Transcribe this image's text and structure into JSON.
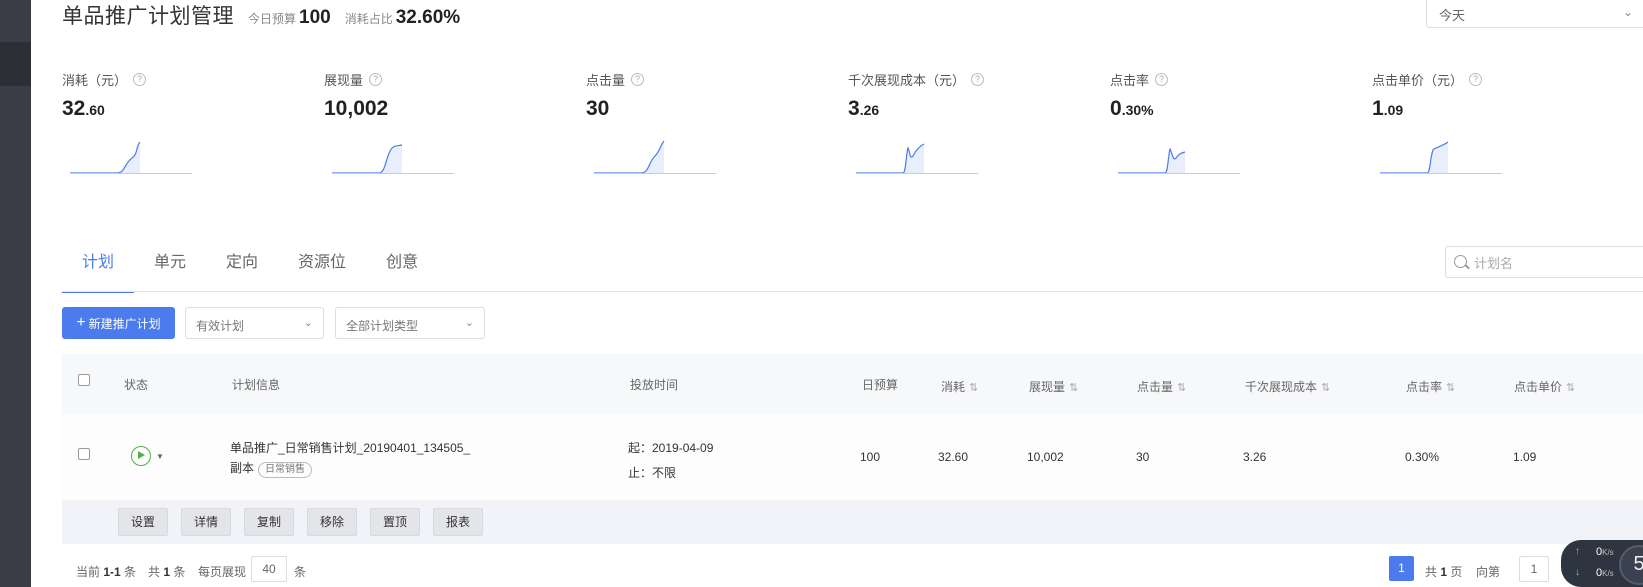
{
  "header": {
    "title": "单品推广计划管理",
    "budget_label": "今日预算",
    "budget_value": "100",
    "ratio_label": "消耗占比",
    "ratio_value": "32.60%",
    "date_select": "今天"
  },
  "metrics": [
    {
      "label": "消耗（元）",
      "value_int": "32",
      "value_frac": ".60"
    },
    {
      "label": "展现量",
      "value_int": "10,002",
      "value_frac": ""
    },
    {
      "label": "点击量",
      "value_int": "30",
      "value_frac": ""
    },
    {
      "label": "千次展现成本（元）",
      "value_int": "3",
      "value_frac": ".26"
    },
    {
      "label": "点击率",
      "value_int": "0",
      "value_frac": ".30%"
    },
    {
      "label": "点击单价（元）",
      "value_int": "1",
      "value_frac": ".09"
    }
  ],
  "tabs": [
    "计划",
    "单元",
    "定向",
    "资源位",
    "创意"
  ],
  "search": {
    "placeholder": "计划名"
  },
  "toolbar": {
    "new_button": "新建推广计划",
    "filter_status": "有效计划",
    "filter_type": "全部计划类型"
  },
  "table": {
    "headers": {
      "status": "状态",
      "info": "计划信息",
      "time": "投放时间",
      "budget": "日预算",
      "cost": "消耗",
      "impressions": "展现量",
      "clicks": "点击量",
      "cpm": "千次展现成本",
      "ctr": "点击率",
      "cpc": "点击单价"
    },
    "rows": [
      {
        "name_line1": "单品推广_日常销售计划_20190401_134505_",
        "name_line2": "副本",
        "tag": "日常销售",
        "start": "起：2019-04-09",
        "end": "止：不限",
        "budget": "100",
        "cost": "32.60",
        "impressions": "10,002",
        "clicks": "30",
        "cpm": "3.26",
        "ctr": "0.30%",
        "cpc": "1.09"
      }
    ],
    "actions": [
      "设置",
      "详情",
      "复制",
      "移除",
      "置顶",
      "报表"
    ]
  },
  "footer": {
    "current_label": "当前",
    "current_range": "1-1",
    "current_unit": "条",
    "total_label": "共",
    "total_count": "1",
    "total_unit": "条",
    "per_page_label": "每页展现",
    "per_page_value": "40",
    "per_page_unit": "条",
    "page_current": "1",
    "pages_label": "共",
    "pages_count": "1",
    "pages_unit": "页",
    "goto_label": "向第",
    "goto_value": "1"
  },
  "network": {
    "up": "0",
    "down": "0",
    "unit": "K/s",
    "ring_value": "5"
  }
}
